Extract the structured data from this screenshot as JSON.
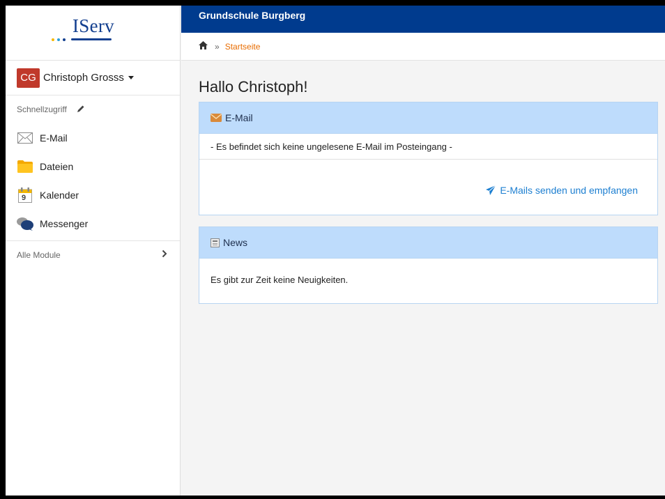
{
  "logo": {
    "text": "IServ",
    "dot_colors": [
      "#f6b800",
      "#2a9fd8",
      "#133f8f"
    ]
  },
  "user": {
    "initials": "CG",
    "name": "Christoph Grosss"
  },
  "sidebar": {
    "quick_access_label": "Schnellzugriff",
    "items": [
      {
        "label": "E-Mail",
        "icon": "envelope-icon"
      },
      {
        "label": "Dateien",
        "icon": "folder-icon"
      },
      {
        "label": "Kalender",
        "icon": "calendar-icon",
        "icon_text": "9"
      },
      {
        "label": "Messenger",
        "icon": "chat-bubbles-icon"
      }
    ],
    "all_modules_label": "Alle Module"
  },
  "header": {
    "school_name": "Grundschule Burgberg"
  },
  "breadcrumb": {
    "separator": "»",
    "current": "Startseite"
  },
  "main": {
    "greeting": "Hallo Christoph!",
    "mail_panel": {
      "title": "E-Mail",
      "message": "- Es befindet sich keine ungelesene E-Mail im Posteingang -",
      "action": "E-Mails senden und empfangen"
    },
    "news_panel": {
      "title": "News",
      "message": "Es gibt zur Zeit keine Neuigkeiten."
    }
  },
  "colors": {
    "topbar": "#003b8e",
    "accent_link": "#1d7fd1",
    "breadcrumb_link": "#e86c00",
    "avatar": "#c0392b",
    "panel_header": "#bedcfc"
  }
}
